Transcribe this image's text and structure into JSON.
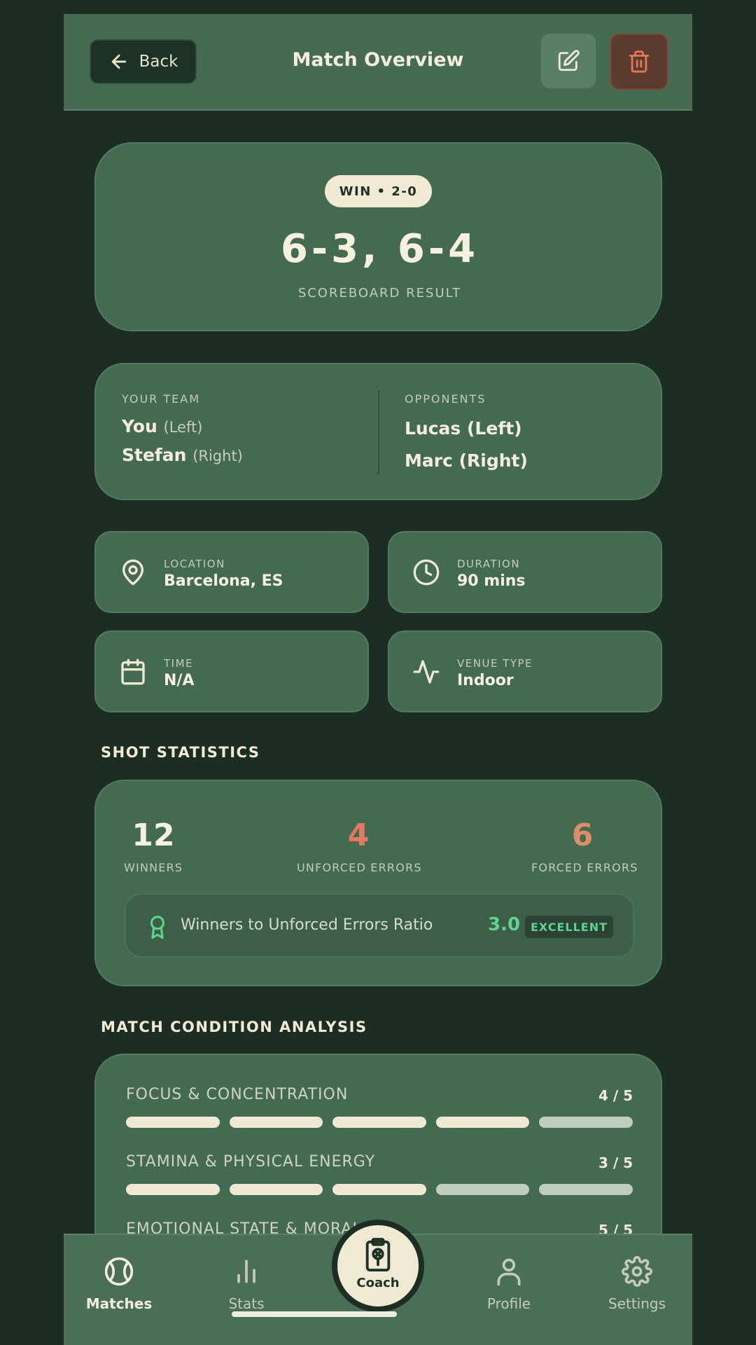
{
  "header": {
    "back_label": "Back",
    "title": "Match Overview"
  },
  "result": {
    "badge": "WIN • 2-0",
    "score": "6-3, 6-4",
    "label": "SCOREBOARD RESULT"
  },
  "teams": {
    "your_team_label": "YOUR TEAM",
    "your_team": [
      {
        "name": "You",
        "side": "(Left)"
      },
      {
        "name": "Stefan",
        "side": "(Right)"
      }
    ],
    "opponents_label": "OPPONENTS",
    "opponents": [
      "Lucas (Left)",
      "Marc (Right)"
    ]
  },
  "info": {
    "location": {
      "label": "LOCATION",
      "value": "Barcelona, ES",
      "icon": "map-pin-icon"
    },
    "duration": {
      "label": "DURATION",
      "value": "90 mins",
      "icon": "clock-icon"
    },
    "time": {
      "label": "TIME",
      "value": "N/A",
      "icon": "calendar-icon"
    },
    "venue": {
      "label": "VENUE TYPE",
      "value": "Indoor",
      "icon": "activity-icon"
    }
  },
  "shot_statistics": {
    "title": "SHOT STATISTICS",
    "winners": {
      "value": "12",
      "label": "WINNERS"
    },
    "unforced": {
      "value": "4",
      "label": "UNFORCED ERRORS"
    },
    "forced": {
      "value": "6",
      "label": "FORCED ERRORS"
    },
    "ratio": {
      "label": "Winners to Unforced Errors Ratio",
      "value": "3.0",
      "badge": "EXCELLENT"
    }
  },
  "condition": {
    "title": "MATCH CONDITION ANALYSIS",
    "rows": [
      {
        "label": "FOCUS & CONCENTRATION",
        "score": "4 / 5",
        "level": 4,
        "max": 5
      },
      {
        "label": "STAMINA & PHYSICAL ENERGY",
        "score": "3 / 5",
        "level": 3,
        "max": 5
      },
      {
        "label": "EMOTIONAL STATE & MORALE",
        "score": "5 / 5",
        "level": 5,
        "max": 5
      }
    ]
  },
  "nav": {
    "matches": "Matches",
    "stats": "Stats",
    "coach": "Coach",
    "profile": "Profile",
    "settings": "Settings"
  },
  "colors": {
    "background": "#1c2e24",
    "card": "#456a52",
    "cream": "#f0e9d4",
    "unforced": "#e07a62",
    "forced": "#d99069",
    "excellent": "#5ed48c",
    "delete": "#e07a55"
  }
}
